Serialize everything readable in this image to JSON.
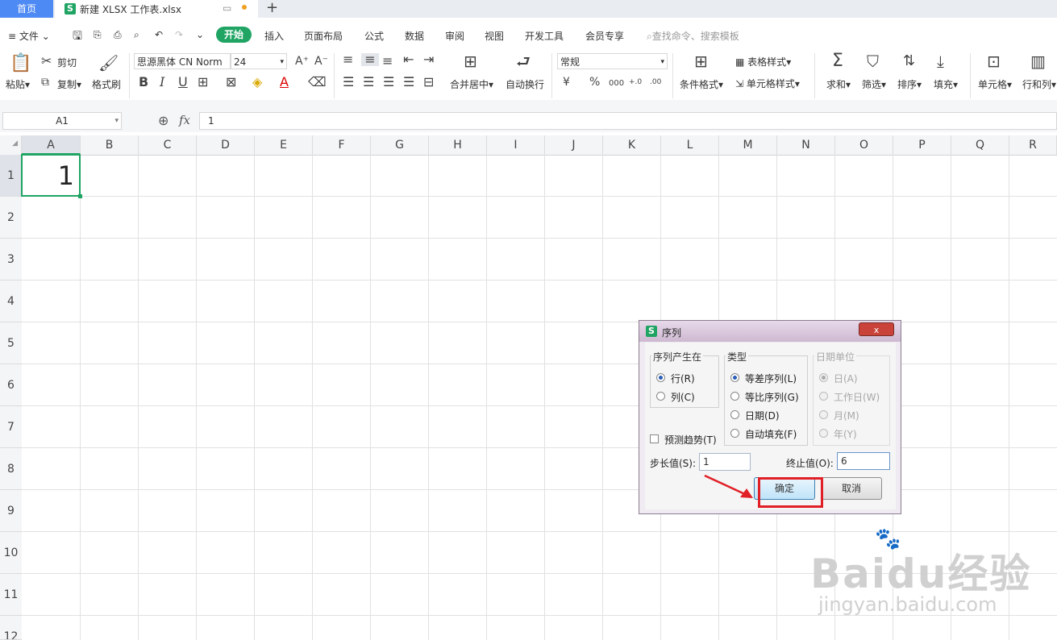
{
  "titlebar": {
    "home_tab": "首页",
    "file_tab": "新建 XLSX 工作表.xlsx",
    "new_tab": "+"
  },
  "menu": {
    "file": "文件",
    "tabs": [
      "开始",
      "插入",
      "页面布局",
      "公式",
      "数据",
      "审阅",
      "视图",
      "开发工具",
      "会员专享"
    ],
    "search_placeholder": "查找命令、搜索模板"
  },
  "ribbon": {
    "paste": "粘贴",
    "cut": "剪切",
    "copy": "复制",
    "format_painter": "格式刷",
    "font_name": "思源黑体 CN Norm",
    "font_size": "24",
    "bold": "B",
    "italic": "I",
    "underline": "U",
    "merge_center": "合并居中",
    "wrap_text": "自动换行",
    "number_format": "常规",
    "currency": "¥",
    "percent": "%",
    "thousands": "000",
    "inc_decimal": "+.0",
    "dec_decimal": ".00",
    "conditional_format": "条件格式",
    "table_style": "表格样式",
    "cell_style": "单元格样式",
    "sum": "求和",
    "filter": "筛选",
    "sort": "排序",
    "fill": "填充",
    "cell": "单元格",
    "row_col": "行和列"
  },
  "formula_bar": {
    "name_box": "A1",
    "fx": "fx",
    "value": "1"
  },
  "grid": {
    "columns": [
      "A",
      "B",
      "C",
      "D",
      "E",
      "F",
      "G",
      "H",
      "I",
      "J",
      "K",
      "L",
      "M",
      "N",
      "O",
      "P",
      "Q",
      "R"
    ],
    "rows": [
      "1",
      "2",
      "3",
      "4",
      "5",
      "6",
      "7",
      "8",
      "9",
      "10",
      "11",
      "12"
    ],
    "a1_value": "1"
  },
  "dialog": {
    "title": "序列",
    "close": "x",
    "series_in": {
      "title": "序列产生在",
      "options": [
        "行(R)",
        "列(C)"
      ],
      "selected": "行(R)"
    },
    "type": {
      "title": "类型",
      "options": [
        "等差序列(L)",
        "等比序列(G)",
        "日期(D)",
        "自动填充(F)"
      ],
      "selected": "等差序列(L)"
    },
    "date_unit": {
      "title": "日期单位",
      "options": [
        "日(A)",
        "工作日(W)",
        "月(M)",
        "年(Y)"
      ],
      "selected": "日(A)"
    },
    "trend": "预测趋势(T)",
    "step_label": "步长值(S):",
    "step_value": "1",
    "stop_label": "终止值(O):",
    "stop_value": "6",
    "ok": "确定",
    "cancel": "取消"
  },
  "watermark": {
    "brand": "Baidu经验",
    "url": "jingyan.baidu.com"
  },
  "colors": {
    "accent": "#1fa463",
    "highlight": "#e01f26",
    "home_tab": "#4e8af4"
  }
}
